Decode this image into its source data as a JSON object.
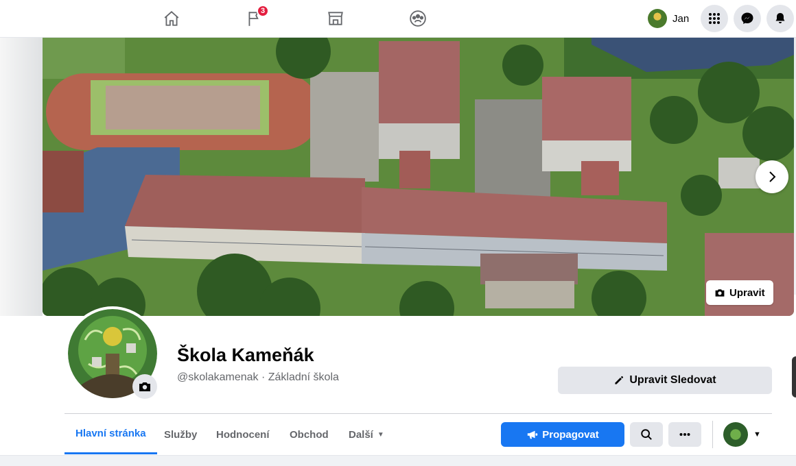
{
  "topbar": {
    "nav": [
      {
        "name": "home",
        "icon": "home-icon"
      },
      {
        "name": "pages",
        "icon": "flag-icon",
        "badge": "3"
      },
      {
        "name": "marketplace",
        "icon": "store-icon"
      },
      {
        "name": "groups",
        "icon": "groups-icon"
      }
    ],
    "user_name": "Jan",
    "menu_icon": "grid-menu-icon",
    "messenger_icon": "messenger-icon",
    "notifications_icon": "bell-icon"
  },
  "cover": {
    "edit_label": "Upravit",
    "next_icon": "chevron-right-icon"
  },
  "page": {
    "name": "Škola Kameňák",
    "subtitle": "@skolakamenak · Základní škola",
    "edit_follow_label": "Upravit Sledovat"
  },
  "tabs": [
    {
      "label": "Hlavní stránka",
      "active": true
    },
    {
      "label": "Služby"
    },
    {
      "label": "Hodnocení"
    },
    {
      "label": "Obchod"
    },
    {
      "label": "Další"
    }
  ],
  "actions": {
    "promote_label": "Propagovat",
    "search_icon": "search-icon",
    "more_icon": "more-icon"
  },
  "colors": {
    "accent": "#1877f2",
    "badge": "#e41e3f",
    "secondary_bg": "#e4e6eb"
  }
}
